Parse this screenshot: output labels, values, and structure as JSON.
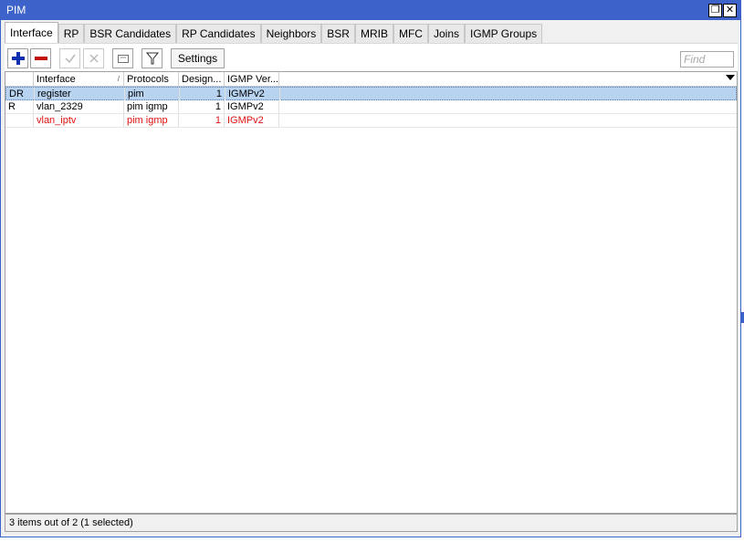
{
  "window": {
    "title": "PIM",
    "restore_glyph": "❐",
    "close_glyph": "✕"
  },
  "tabs": [
    {
      "label": "Interface",
      "active": true
    },
    {
      "label": "RP"
    },
    {
      "label": "BSR Candidates"
    },
    {
      "label": "RP Candidates"
    },
    {
      "label": "Neighbors"
    },
    {
      "label": "BSR"
    },
    {
      "label": "MRIB"
    },
    {
      "label": "MFC"
    },
    {
      "label": "Joins"
    },
    {
      "label": "IGMP Groups"
    }
  ],
  "toolbar": {
    "add_icon": "plus-icon",
    "remove_icon": "minus-icon",
    "enable_icon": "check-icon",
    "disable_icon": "cross-icon",
    "comment_icon": "comment-icon",
    "filter_icon": "filter-icon",
    "settings_label": "Settings",
    "find_placeholder": "Find"
  },
  "table": {
    "columns": [
      {
        "label": ""
      },
      {
        "label": "Interface",
        "sort": "/"
      },
      {
        "label": "Protocols"
      },
      {
        "label": "Design..."
      },
      {
        "label": "IGMP Ver..."
      }
    ],
    "rows": [
      {
        "flag": "DR",
        "interface": "register",
        "protocols": "pim",
        "designated": "1",
        "igmp_version": "IGMPv2",
        "selected": true,
        "color": "#000000"
      },
      {
        "flag": "R",
        "interface": "vlan_2329",
        "protocols": "pim igmp",
        "designated": "1",
        "igmp_version": "IGMPv2",
        "selected": false,
        "color": "#000000"
      },
      {
        "flag": "",
        "interface": "vlan_iptv",
        "protocols": "pim igmp",
        "designated": "1",
        "igmp_version": "IGMPv2",
        "selected": false,
        "color": "#e01010"
      }
    ]
  },
  "status": {
    "text": "3 items out of 2 (1 selected)"
  },
  "colors": {
    "titlebar": "#3d63ca",
    "selection": "#b8d3f0",
    "disabled_row": "#e01010",
    "add": "#1030b0",
    "remove": "#c01010"
  }
}
